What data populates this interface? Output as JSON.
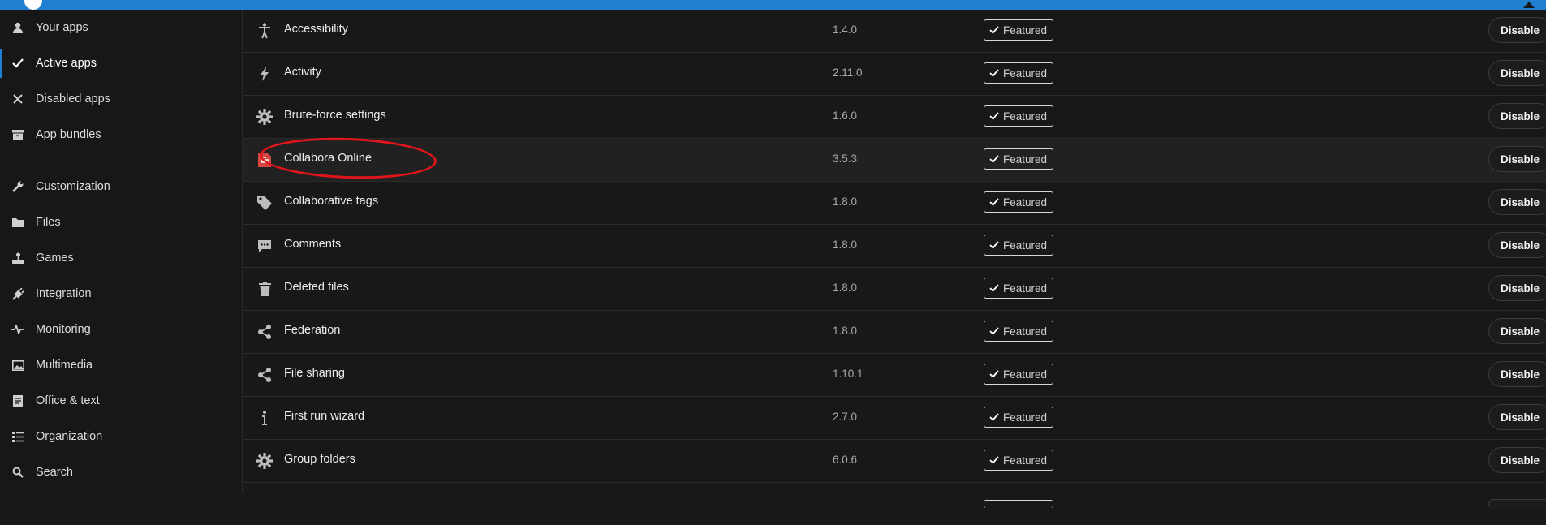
{
  "sidebar": {
    "items": [
      {
        "label": "Your apps",
        "icon": "user-icon",
        "active": false
      },
      {
        "label": "Active apps",
        "icon": "check-icon",
        "active": true
      },
      {
        "label": "Disabled apps",
        "icon": "close-icon",
        "active": false
      },
      {
        "label": "App bundles",
        "icon": "archive-icon",
        "active": false
      },
      {
        "label": "Customization",
        "icon": "wrench-icon",
        "active": false
      },
      {
        "label": "Files",
        "icon": "folder-icon",
        "active": false
      },
      {
        "label": "Games",
        "icon": "joystick-icon",
        "active": false
      },
      {
        "label": "Integration",
        "icon": "plug-icon",
        "active": false
      },
      {
        "label": "Monitoring",
        "icon": "pulse-icon",
        "active": false
      },
      {
        "label": "Multimedia",
        "icon": "image-icon",
        "active": false
      },
      {
        "label": "Office & text",
        "icon": "document-icon",
        "active": false
      },
      {
        "label": "Organization",
        "icon": "list-icon",
        "active": false
      },
      {
        "label": "Search",
        "icon": "search-icon",
        "active": false
      }
    ]
  },
  "apps": {
    "badge_label": "Featured",
    "disable_label": "Disable",
    "rows": [
      {
        "name": "Accessibility",
        "version": "1.4.0",
        "icon": "accessibility-icon"
      },
      {
        "name": "Activity",
        "version": "2.11.0",
        "icon": "lightning-icon"
      },
      {
        "name": "Brute-force settings",
        "version": "1.6.0",
        "icon": "gear-icon"
      },
      {
        "name": "Collabora Online",
        "version": "3.5.3",
        "icon": "collabora-icon"
      },
      {
        "name": "Collaborative tags",
        "version": "1.8.0",
        "icon": "tag-icon"
      },
      {
        "name": "Comments",
        "version": "1.8.0",
        "icon": "comment-icon"
      },
      {
        "name": "Deleted files",
        "version": "1.8.0",
        "icon": "trash-icon"
      },
      {
        "name": "Federation",
        "version": "1.8.0",
        "icon": "share-icon"
      },
      {
        "name": "File sharing",
        "version": "1.10.1",
        "icon": "share-icon"
      },
      {
        "name": "First run wizard",
        "version": "2.7.0",
        "icon": "info-icon"
      },
      {
        "name": "Group folders",
        "version": "6.0.6",
        "icon": "gear-icon"
      }
    ]
  },
  "colors": {
    "accent": "#1f7fd1",
    "annotation": "#e0151b",
    "background": "#181818"
  }
}
